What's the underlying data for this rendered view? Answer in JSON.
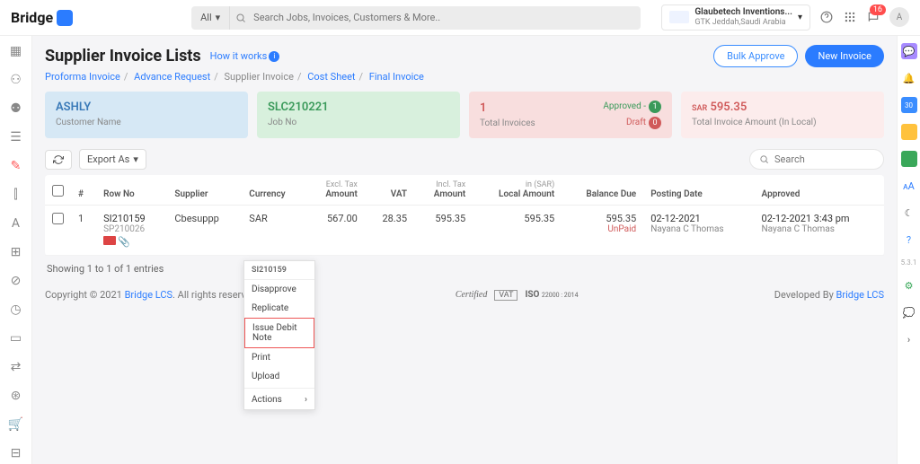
{
  "header": {
    "brand_text": "Bridge",
    "filter_label": "All",
    "search_placeholder": "Search Jobs, Invoices, Customers & More..",
    "company_name": "Glaubetech Inventions...",
    "company_sub": "GTK Jeddah,Saudi Arabia",
    "notif_count": "16",
    "avatar_initial": "A"
  },
  "page": {
    "title": "Supplier Invoice Lists",
    "how_it_works": "How it works",
    "bulk_approve": "Bulk Approve",
    "new_invoice": "New Invoice"
  },
  "breadcrumb": {
    "a": "Proforma Invoice",
    "b": "Advance Request",
    "c": "Supplier Invoice",
    "d": "Cost Sheet",
    "e": "Final Invoice"
  },
  "cards": {
    "c1_title": "ASHLY",
    "c1_sub": "Customer Name",
    "c2_title": "SLC210221",
    "c2_sub": "Job No",
    "c3_title": "1",
    "c3_sub": "Total Invoices",
    "c3_approved_label": "Approved -",
    "c3_approved_count": "1",
    "c3_draft_label": "Draft",
    "c3_draft_count": "0",
    "c4_currency": "SAR",
    "c4_amount": "595.35",
    "c4_sub": "Total Invoice Amount (In Local)"
  },
  "toolbar": {
    "export_label": "Export As",
    "search_placeholder": "Search"
  },
  "table": {
    "headers": {
      "hash": "#",
      "rowno": "Row No",
      "supplier": "Supplier",
      "currency": "Currency",
      "excl_sub": "Excl. Tax",
      "amount": "Amount",
      "vat": "VAT",
      "incl_sub": "Incl. Tax",
      "incl_amount": "Amount",
      "insar_sub": "in (SAR)",
      "local_amount": "Local Amount",
      "balance_due": "Balance Due",
      "posting_date": "Posting Date",
      "approved": "Approved"
    },
    "row": {
      "idx": "1",
      "rowno": "SI210159",
      "rowno_sub": "SP210026",
      "supplier": "Cbesuppp",
      "currency": "SAR",
      "excl_amount": "567.00",
      "vat": "28.35",
      "incl_amount": "595.35",
      "local_amount": "595.35",
      "balance_due": "595.35",
      "balance_status": "UnPaid",
      "posting_date": "02-12-2021",
      "posting_user": "Nayana C Thomas",
      "approved_date": "02-12-2021 3:43 pm",
      "approved_user": "Nayana C Thomas"
    },
    "info": "Showing 1 to 1 of 1 entries"
  },
  "context_menu": {
    "header": "SI210159",
    "disapprove": "Disapprove",
    "replicate": "Replicate",
    "issue_debit": "Issue Debit Note",
    "print": "Print",
    "upload": "Upload",
    "actions": "Actions"
  },
  "footer": {
    "copy_prefix": "Copyright © 2021 ",
    "copy_link": "Bridge LCS",
    "copy_suffix": ". All rights reserved.",
    "cert": "Certified",
    "vat": "VAT",
    "iso": "ISO",
    "iso_sub": "22000 : 2014",
    "dev_prefix": "Developed By ",
    "dev_link": "Bridge LCS"
  },
  "rightbar": {
    "cal": "30",
    "aa": "ᴀA",
    "ver": "5.3.1"
  }
}
